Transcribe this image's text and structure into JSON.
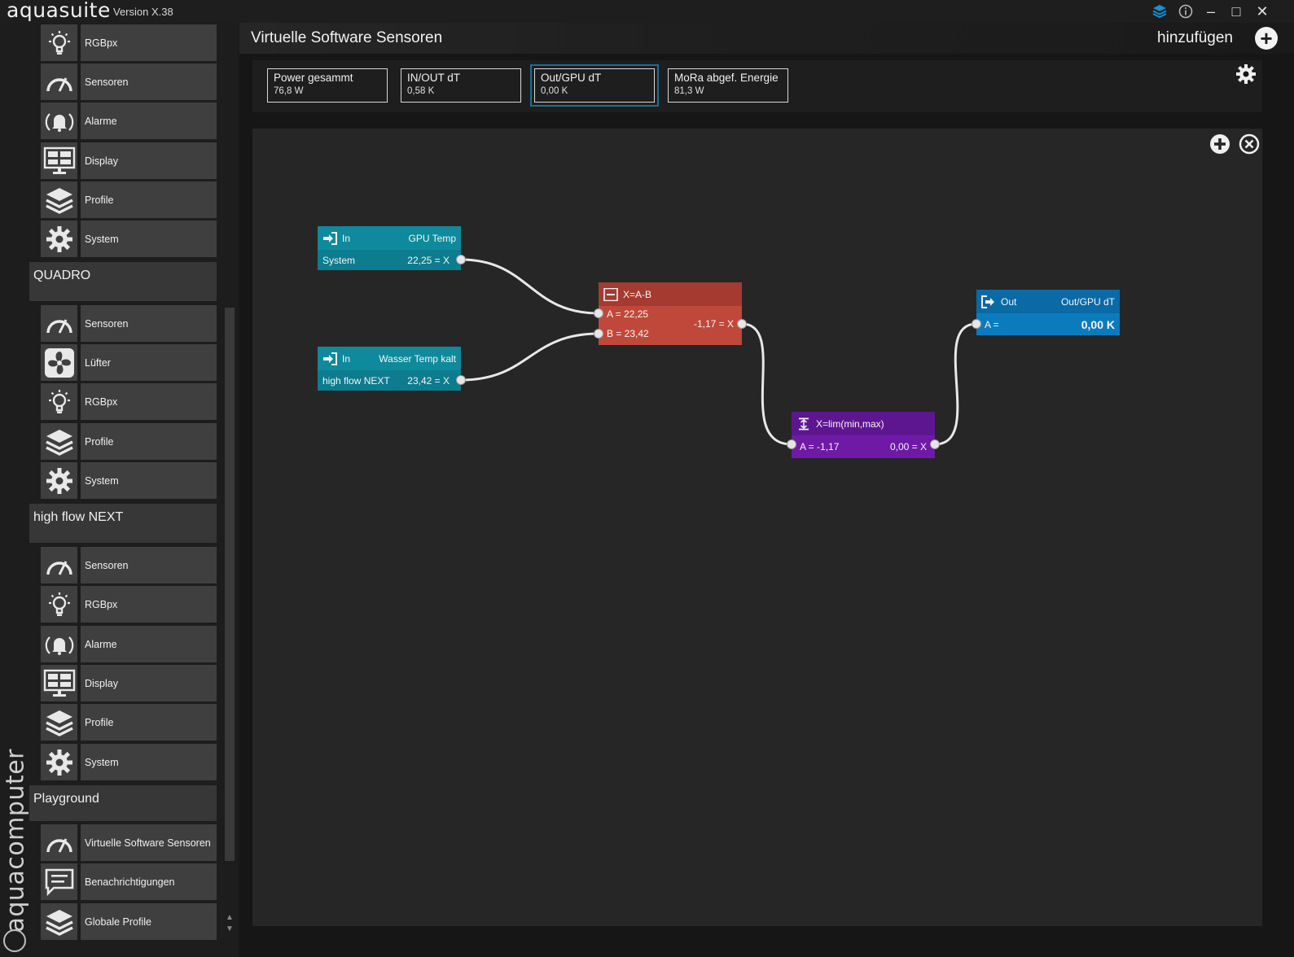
{
  "app": {
    "title": "aquasuite",
    "version": "Version X.38"
  },
  "window_controls": {
    "minimize": "–",
    "maximize": "□",
    "close": "✕"
  },
  "sidebar": {
    "group1": [
      {
        "label": "RGBpx",
        "icon": "bulb-icon"
      },
      {
        "label": "Sensoren",
        "icon": "gauge-icon"
      },
      {
        "label": "Alarme",
        "icon": "alarm-icon"
      },
      {
        "label": "Display",
        "icon": "display-icon"
      },
      {
        "label": "Profile",
        "icon": "layers-icon"
      },
      {
        "label": "System",
        "icon": "gear-icon"
      }
    ],
    "section_quadro": "QUADRO",
    "quadro": [
      {
        "label": "Sensoren",
        "icon": "gauge-icon"
      },
      {
        "label": "Lüfter",
        "icon": "fan-icon"
      },
      {
        "label": "RGBpx",
        "icon": "bulb-icon"
      },
      {
        "label": "Profile",
        "icon": "layers-icon"
      },
      {
        "label": "System",
        "icon": "gear-icon"
      }
    ],
    "section_highflow": "high flow NEXT",
    "highflow": [
      {
        "label": "Sensoren",
        "icon": "gauge-icon"
      },
      {
        "label": "RGBpx",
        "icon": "bulb-icon"
      },
      {
        "label": "Alarme",
        "icon": "alarm-icon"
      },
      {
        "label": "Display",
        "icon": "display-icon"
      },
      {
        "label": "Profile",
        "icon": "layers-icon"
      },
      {
        "label": "System",
        "icon": "gear-icon"
      }
    ],
    "section_playground": "Playground",
    "playground": [
      {
        "label": "Virtuelle Software Sensoren",
        "icon": "gauge-icon"
      },
      {
        "label": "Benachrichtigungen",
        "icon": "message-icon"
      },
      {
        "label": "Globale Profile",
        "icon": "layers-icon"
      }
    ],
    "brand": "aquacomputer"
  },
  "header": {
    "title": "Virtuelle Software Sensoren",
    "add_label": "hinzufügen"
  },
  "sensors": [
    {
      "name": "Power gesammt",
      "value": "76,8 W"
    },
    {
      "name": "IN/OUT dT",
      "value": "0,58 K"
    },
    {
      "name": "Out/GPU dT",
      "value": "0,00 K",
      "active": true
    },
    {
      "name": "MoRa abgef. Energie",
      "value": "81,3 W"
    }
  ],
  "nodes": {
    "in_gpu": {
      "type": "In",
      "name": "GPU Temp",
      "source": "System",
      "value": "22,25 = X",
      "color": "#0e8a9c"
    },
    "in_water": {
      "type": "In",
      "name": "Wasser Temp kalt",
      "source": "high flow NEXT",
      "value": "23,42 = X",
      "color": "#0e8a9c"
    },
    "sub": {
      "title": "X=A-B",
      "a": "A = 22,25",
      "b": "B = 23,42",
      "out": "-1,17 = X",
      "color": "#c0483a",
      "head_color": "#a43a30"
    },
    "lim": {
      "title": "X=lim(min,max)",
      "a": "A = -1,17",
      "out": "0,00 = X",
      "color": "#6f1aa6",
      "head_color": "#5e1690"
    },
    "out": {
      "type": "Out",
      "name": "Out/GPU dT",
      "a": "A =",
      "value": "0,00 K",
      "color": "#0c7bbd",
      "head_color": "#0a6aa6"
    }
  }
}
